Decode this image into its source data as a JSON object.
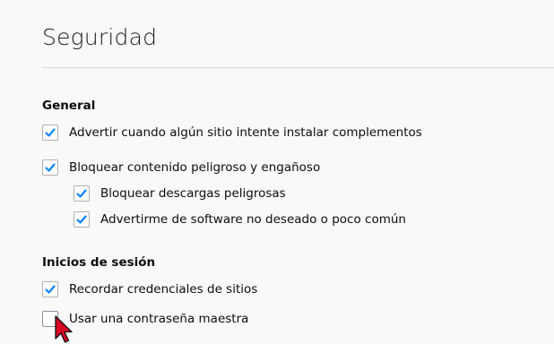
{
  "page": {
    "title": "Seguridad"
  },
  "sections": {
    "general": {
      "heading": "General",
      "items": [
        {
          "label": "Advertir cuando algún sitio intente instalar complementos",
          "checked": true
        },
        {
          "label": "Bloquear contenido peligroso y engañoso",
          "checked": true
        },
        {
          "label": "Bloquear descargas peligrosas",
          "checked": true
        },
        {
          "label": "Advertirme de software no deseado o poco común",
          "checked": true
        }
      ]
    },
    "logins": {
      "heading": "Inicios de sesión",
      "items": [
        {
          "label": "Recordar credenciales de sitios",
          "checked": true
        },
        {
          "label": "Usar una contraseña maestra",
          "checked": false
        }
      ]
    }
  },
  "colors": {
    "check_accent": "#0a84ff",
    "cursor": "#d70022"
  },
  "icons": {
    "check": "check-icon",
    "cursor": "mouse-pointer-icon"
  }
}
